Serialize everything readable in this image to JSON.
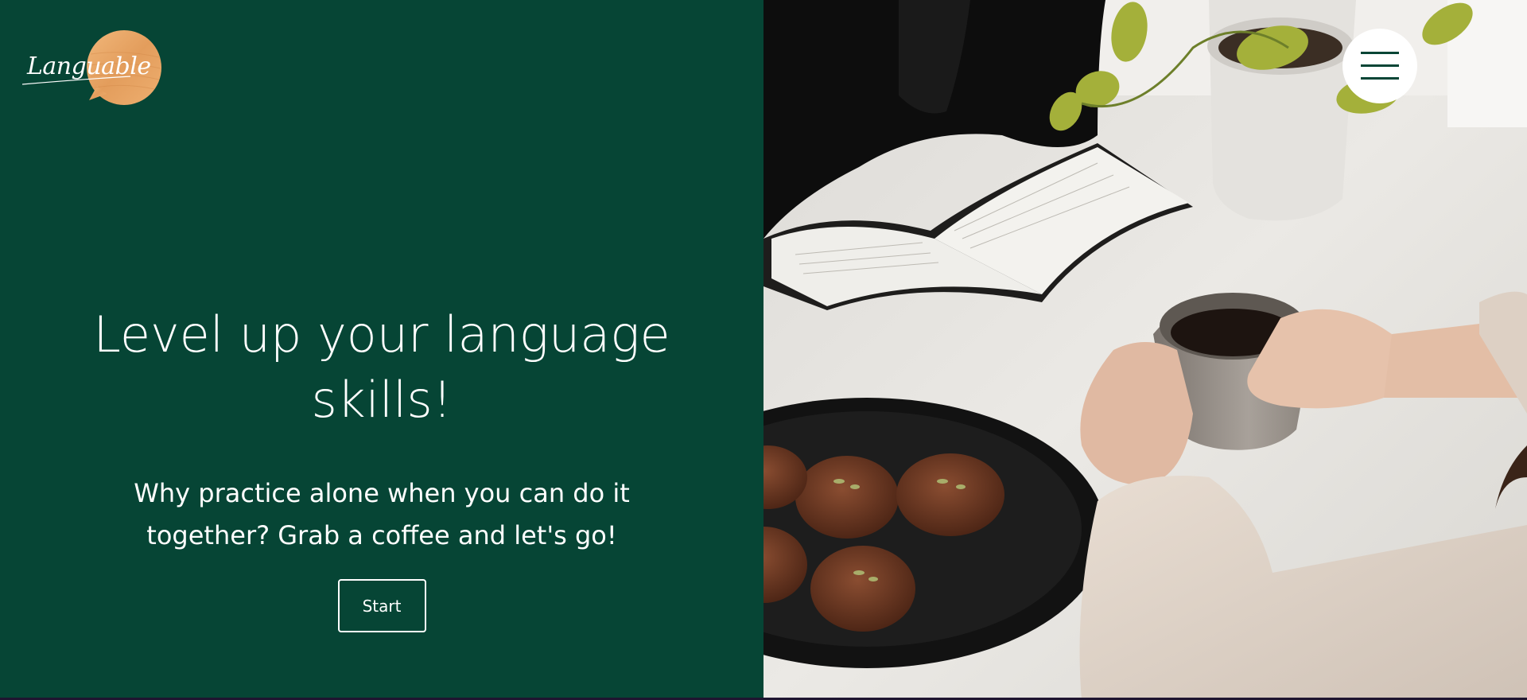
{
  "brand": {
    "logo_text": "Languable",
    "primary_color": "#064535",
    "accent_color": "#e8a565"
  },
  "hero": {
    "title": "Level up your language skills!",
    "subtitle": "Why practice alone when you can do it together? Grab a coffee and let's go!",
    "cta_label": "Start"
  },
  "header": {
    "menu_icon": "hamburger-menu-icon"
  }
}
